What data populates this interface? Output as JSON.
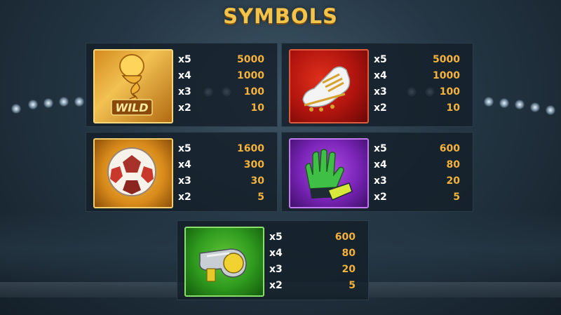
{
  "title": "SYMBOLS",
  "symbols": [
    {
      "name": "wild-trophy",
      "icon": "trophy-icon",
      "icon_text": "WILD",
      "payouts": [
        {
          "mult": "x5",
          "value": "5000"
        },
        {
          "mult": "x4",
          "value": "1000"
        },
        {
          "mult": "x3",
          "value": "100"
        },
        {
          "mult": "x2",
          "value": "10"
        }
      ]
    },
    {
      "name": "football-boot",
      "icon": "boot-icon",
      "payouts": [
        {
          "mult": "x5",
          "value": "5000"
        },
        {
          "mult": "x4",
          "value": "1000"
        },
        {
          "mult": "x3",
          "value": "100"
        },
        {
          "mult": "x2",
          "value": "10"
        }
      ]
    },
    {
      "name": "football",
      "icon": "ball-icon",
      "payouts": [
        {
          "mult": "x5",
          "value": "1600"
        },
        {
          "mult": "x4",
          "value": "300"
        },
        {
          "mult": "x3",
          "value": "30"
        },
        {
          "mult": "x2",
          "value": "5"
        }
      ]
    },
    {
      "name": "goalkeeper-gloves",
      "icon": "glove-icon",
      "payouts": [
        {
          "mult": "x5",
          "value": "600"
        },
        {
          "mult": "x4",
          "value": "80"
        },
        {
          "mult": "x3",
          "value": "20"
        },
        {
          "mult": "x2",
          "value": "5"
        }
      ]
    },
    {
      "name": "whistle",
      "icon": "whistle-icon",
      "payouts": [
        {
          "mult": "x5",
          "value": "600"
        },
        {
          "mult": "x4",
          "value": "80"
        },
        {
          "mult": "x3",
          "value": "20"
        },
        {
          "mult": "x2",
          "value": "5"
        }
      ]
    }
  ],
  "colors": {
    "title": "#f3c34a",
    "value": "#f4b23c",
    "multiplier": "#ffffff"
  }
}
